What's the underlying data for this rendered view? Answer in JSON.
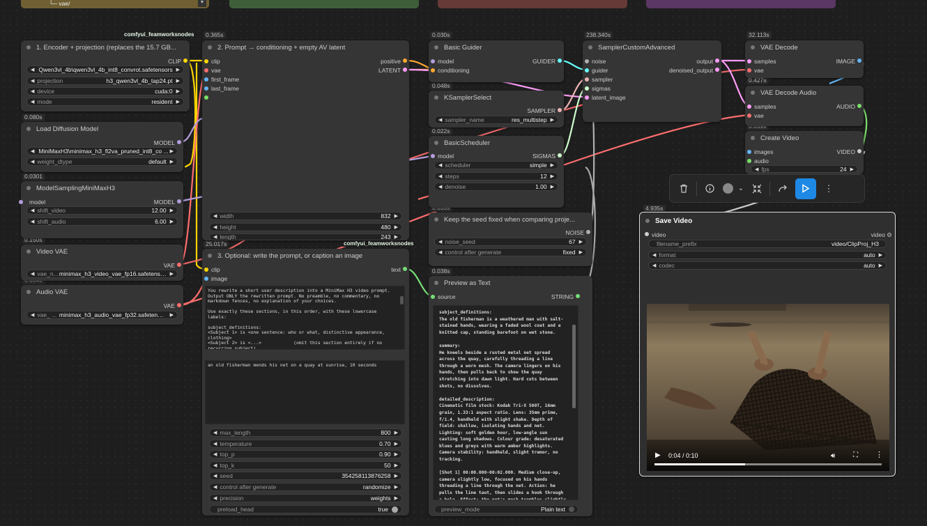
{
  "top_fragment": {
    "text": "└─ vae/"
  },
  "tags": {
    "t1": "comfyui_feamworksnodes",
    "t2": "comfyui_feamworksnodes"
  },
  "times": {
    "encoder": "",
    "prompt": "0.365s",
    "load_diff": "0.080s",
    "msmm": "0.0301",
    "vvae": "0.150s",
    "avae": "0.034s",
    "optional": "25.017s",
    "guider": "0.030s",
    "ksel": "0.048s",
    "bsched": "0.022s",
    "seed": "0.035s",
    "preview": "0.038s",
    "sampler": "238.340s",
    "vaedec": "32.113s",
    "vaedecaudio": "0.427s",
    "createvideo": "0.059s",
    "save": "4.935s"
  },
  "encoder": {
    "title": "1. Encoder + projection  (replaces the 15.7 GB...",
    "out": "CLIP",
    "w": [
      {
        "n": "",
        "v": "Qwen3vl_4b\\qwen3vl_4b_int8_convrot.safetensors"
      },
      {
        "n": "projection",
        "v": "h3_qwen3vl_4b_tap24.pt"
      },
      {
        "n": "device",
        "v": "cuda:0"
      },
      {
        "n": "mode",
        "v": "resident"
      }
    ]
  },
  "load_diff": {
    "title": "Load Diffusion Model",
    "out": "MODEL",
    "w": [
      {
        "n": "",
        "v": "MiniMaxH3\\minimax_h3_fl2va_pruned_int8_co ..."
      },
      {
        "n": "weight_dtype",
        "v": "default"
      }
    ]
  },
  "msmm": {
    "title": "ModelSamplingMiniMaxH3",
    "in": "model",
    "out": "MODEL",
    "w": [
      {
        "n": "shift_video",
        "v": "12.00"
      },
      {
        "n": "shift_audio",
        "v": "6.00"
      }
    ]
  },
  "vvae": {
    "title": "Video VAE",
    "out": "VAE",
    "w": [
      {
        "n": "vae_n...",
        "v": "minimax_h3_video_vae_fp16.safetensors"
      }
    ]
  },
  "avae": {
    "title": "Audio VAE",
    "out": "VAE",
    "w": [
      {
        "n": "vae_ ...",
        "v": "minimax_h3_audio_vae_fp32.safetensors"
      }
    ]
  },
  "prompt": {
    "title": "2. Prompt → conditioning + empty AV latent",
    "in": [
      "clip",
      "vae",
      "first_frame",
      "last_frame"
    ],
    "out": [
      "positive",
      "LATENT"
    ],
    "w": [
      {
        "n": "width",
        "v": "832"
      },
      {
        "n": "height",
        "v": "480"
      },
      {
        "n": "length",
        "v": "243"
      }
    ]
  },
  "optional": {
    "title": "3. Optional: write the prompt, or caption an image",
    "in": [
      "clip",
      "image"
    ],
    "out": "text",
    "sys": "You rewrite a short user description into a MiniMax H3 video prompt. Output ONLY the rewritten prompt. No preamble, no commentary, no markdown fences, no explanation of your choices.\n\nUse exactly these sections, in this order, with these lowercase labels:\n\nsubject_definitions:\n<Subject 1> is <one sentence: who or what, distinctive appearance, clothing>\n<Subject 2> is <...>            (omit this section entirely if no recurring subject)\n\nsummary:",
    "user": "an old fisherman mends his net on a quay at sunrise, 10 seconds",
    "w": [
      {
        "n": "max_length",
        "v": "800"
      },
      {
        "n": "temperature",
        "v": "0.70"
      },
      {
        "n": "top_p",
        "v": "0.90"
      },
      {
        "n": "top_k",
        "v": "50"
      },
      {
        "n": "seed",
        "v": "354258113876258"
      },
      {
        "n": "control after generate",
        "v": "randomize"
      },
      {
        "n": "precision",
        "v": "weights"
      }
    ],
    "toggle": {
      "n": "preload_head",
      "v": "true"
    }
  },
  "guider": {
    "title": "Basic Guider",
    "in": [
      "model",
      "conditioning"
    ],
    "out": "GUIDER"
  },
  "ksel": {
    "title": "KSamplerSelect",
    "out": "SAMPLER",
    "w": [
      {
        "n": "sampler_name",
        "v": "res_multistep"
      }
    ]
  },
  "bsched": {
    "title": "BasicScheduler",
    "in": "model",
    "out": "SIGMAS",
    "w": [
      {
        "n": "scheduler",
        "v": "simple"
      },
      {
        "n": "steps",
        "v": "12"
      },
      {
        "n": "denoise",
        "v": "1.00"
      }
    ]
  },
  "seed": {
    "title": "Keep the seed fixed when comparing proje...",
    "out": "NOISE",
    "w": [
      {
        "n": "noise_seed",
        "v": "67"
      },
      {
        "n": "control after generate",
        "v": "fixed"
      }
    ]
  },
  "preview": {
    "title": "Preview as Text",
    "in": "source",
    "out": "STRING",
    "text": "subject_definitions:\nThe old fisherman is a weathered man with salt-stained hands, wearing a faded wool coat and a knitted cap, standing barefoot on wet stone.\n\nsummary:\nHe kneels beside a rusted metal net spread across the quay, carefully threading a line through a worn mesh. The camera lingers on his hands, then pulls back to show the quay stretching into dawn light. Hard cuts between shots, no dissolves.\n\ndetailed_description:\nCinematic film stock: Kodak Tri-X 500T, 16mm grain, 1.33:1 aspect ratio. Lens: 35mm prime, f/1.4, handheld with slight shake. Depth of field: shallow, isolating hands and net. Lighting: soft golden hour, low-angle sun casting long shadows. Colour grade: desaturated blues and greys with warm amber highlights. Camera stability: handheld, slight tremor, no tracking.\n\n[Shot 1] 00:00.000-00:02.000. Medium close-up, camera slightly low, focused on his hands threading a line through the net. Action: he pulls the line taut, then slides a hook through a hole. Effect: the net's mesh trembles slightly under tension.",
    "footer": {
      "n": "preview_mode",
      "v": "Plain text"
    }
  },
  "sampler": {
    "title": "SamplerCustomAdvanced",
    "in": [
      "noise",
      "guider",
      "sampler",
      "sigmas",
      "latent_image"
    ],
    "out": [
      "output",
      "denoised_output"
    ]
  },
  "vaedec": {
    "title": "VAE Decode",
    "in": [
      "samples",
      "vae"
    ],
    "out": "IMAGE"
  },
  "vaedecaudio": {
    "title": "VAE Decode Audio",
    "in": [
      "samples",
      "vae"
    ],
    "out": "AUDIO"
  },
  "createvideo": {
    "title": "Create Video",
    "in": [
      "images",
      "audio"
    ],
    "out": "VIDEO",
    "w": [
      {
        "n": "fps",
        "v": "24"
      }
    ]
  },
  "save": {
    "title": "Save Video",
    "in": "video",
    "out": "video",
    "w": [
      {
        "n": "filename_prefix",
        "v": "video/ClipProj_H3"
      },
      {
        "n": "format",
        "v": "auto"
      },
      {
        "n": "codec",
        "v": "auto"
      }
    ],
    "player": {
      "time": "0:04 / 0:10",
      "progress": 0.4
    }
  },
  "colors": {
    "clip": "#ffd500",
    "vae": "#ff6e6e",
    "model": "#b39ddb",
    "latent": "#ff9cf9",
    "conditioning": "#ffa931",
    "guider": "#66ffff",
    "sampler": "#ecb4b4",
    "sigmas": "#cdffcd",
    "noise": "#b0b0b0",
    "image": "#64b5f6",
    "audio": "#7cdf6a",
    "string": "#77dd77",
    "video": "#cccccc",
    "ui_blue": "#1e88e5"
  },
  "toolbar": {
    "icons": [
      "trash-icon",
      "info-icon",
      "color-circle-icon",
      "chevron-down-icon",
      "collapse-icon",
      "redo-icon",
      "run-icon",
      "more-vertical-icon"
    ]
  }
}
